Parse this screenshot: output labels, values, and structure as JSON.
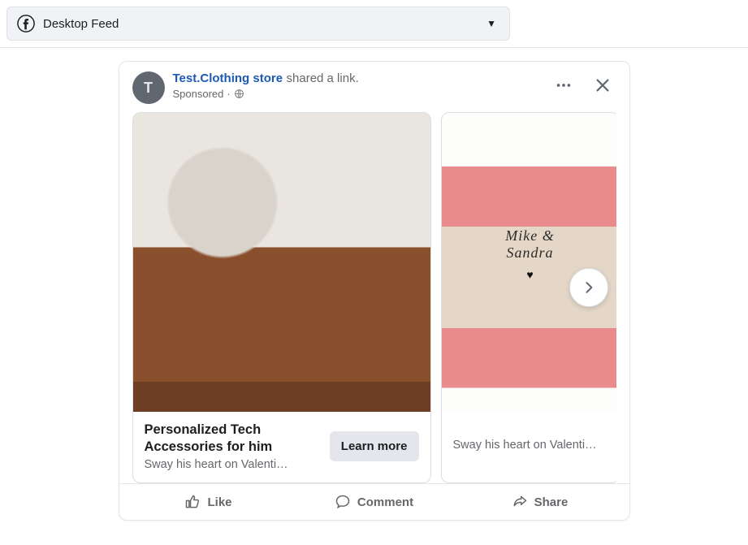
{
  "topbar": {
    "label": "Desktop Feed"
  },
  "post": {
    "avatar_letter": "T",
    "page_name": "Test.Clothing store",
    "shared_text": "shared a link.",
    "sponsored_label": "Sponsored",
    "separator": "·"
  },
  "carousel": {
    "cards": [
      {
        "title": "Personalized Tech Accessories for him",
        "subtitle": "Sway his heart on Valenti…",
        "cta": "Learn more"
      },
      {
        "overlay_text": "Mike & Sandra",
        "subtitle": "Sway his heart on Valenti…"
      }
    ]
  },
  "actions": {
    "like": "Like",
    "comment": "Comment",
    "share": "Share"
  }
}
